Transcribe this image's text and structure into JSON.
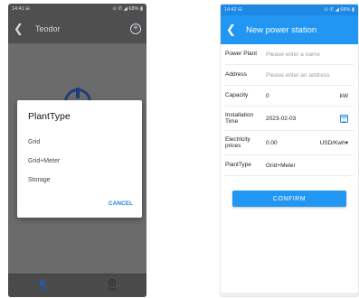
{
  "left": {
    "status": {
      "time": "14:41",
      "icons": "⊟",
      "right": "⊙ ✆ ◢ 68% ▮"
    },
    "appbar": {
      "title": "Teodor"
    },
    "dialog": {
      "title": "PlantType",
      "options": [
        "Grid",
        "Grid+Meter",
        "Storage"
      ],
      "cancel": "CANCEL"
    },
    "nav": {
      "plant": "Plant",
      "user": "User"
    }
  },
  "right": {
    "status": {
      "time": "14:42",
      "icons": "⊟",
      "right": "⊙ ✆ ◢ 68% ▮"
    },
    "appbar": {
      "title": "New power station"
    },
    "form": {
      "plant": {
        "label": "Power Plant",
        "placeholder": "Please enter a name"
      },
      "address": {
        "label": "Address",
        "placeholder": "Please enter an address"
      },
      "capacity": {
        "label": "Capacity",
        "value": "0",
        "unit": "kW"
      },
      "install": {
        "label": "Installation Time",
        "value": "2023-02-03"
      },
      "price": {
        "label": "Electricity prices",
        "value": "0.00",
        "unit": "USD/Kwh▾"
      },
      "type": {
        "label": "PlantType",
        "value": "Grid+Meter"
      }
    },
    "confirm": "CONFIRM"
  },
  "colors": {
    "primary": "#2196f3",
    "overlay": "#6b6b6b",
    "accent": "#1e88e5"
  }
}
